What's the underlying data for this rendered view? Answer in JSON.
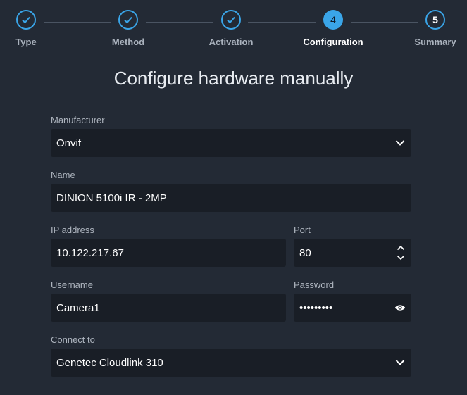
{
  "stepper": {
    "steps": [
      {
        "label": "Type",
        "state": "done",
        "number": ""
      },
      {
        "label": "Method",
        "state": "done",
        "number": ""
      },
      {
        "label": "Activation",
        "state": "done",
        "number": ""
      },
      {
        "label": "Configuration",
        "state": "current",
        "number": "4"
      },
      {
        "label": "Summary",
        "state": "todo",
        "number": "5"
      }
    ]
  },
  "title": "Configure hardware manually",
  "form": {
    "manufacturer": {
      "label": "Manufacturer",
      "value": "Onvif"
    },
    "name": {
      "label": "Name",
      "value": "DINION 5100i IR - 2MP"
    },
    "ip_address": {
      "label": "IP address",
      "value": "10.122.217.67"
    },
    "port": {
      "label": "Port",
      "value": "80"
    },
    "username": {
      "label": "Username",
      "value": "Camera1"
    },
    "password": {
      "label": "Password",
      "value": "•••••••••"
    },
    "connect_to": {
      "label": "Connect to",
      "value": "Genetec Cloudlink 310"
    }
  },
  "icons": {
    "done_step": "check-icon",
    "dropdown": "chevron-down-icon",
    "stepper": [
      "chevron-up-icon",
      "chevron-down-icon"
    ],
    "password_toggle": "eye-icon"
  },
  "colors": {
    "background": "#232a35",
    "field_background": "#191e26",
    "accent": "#3aa5e8"
  }
}
